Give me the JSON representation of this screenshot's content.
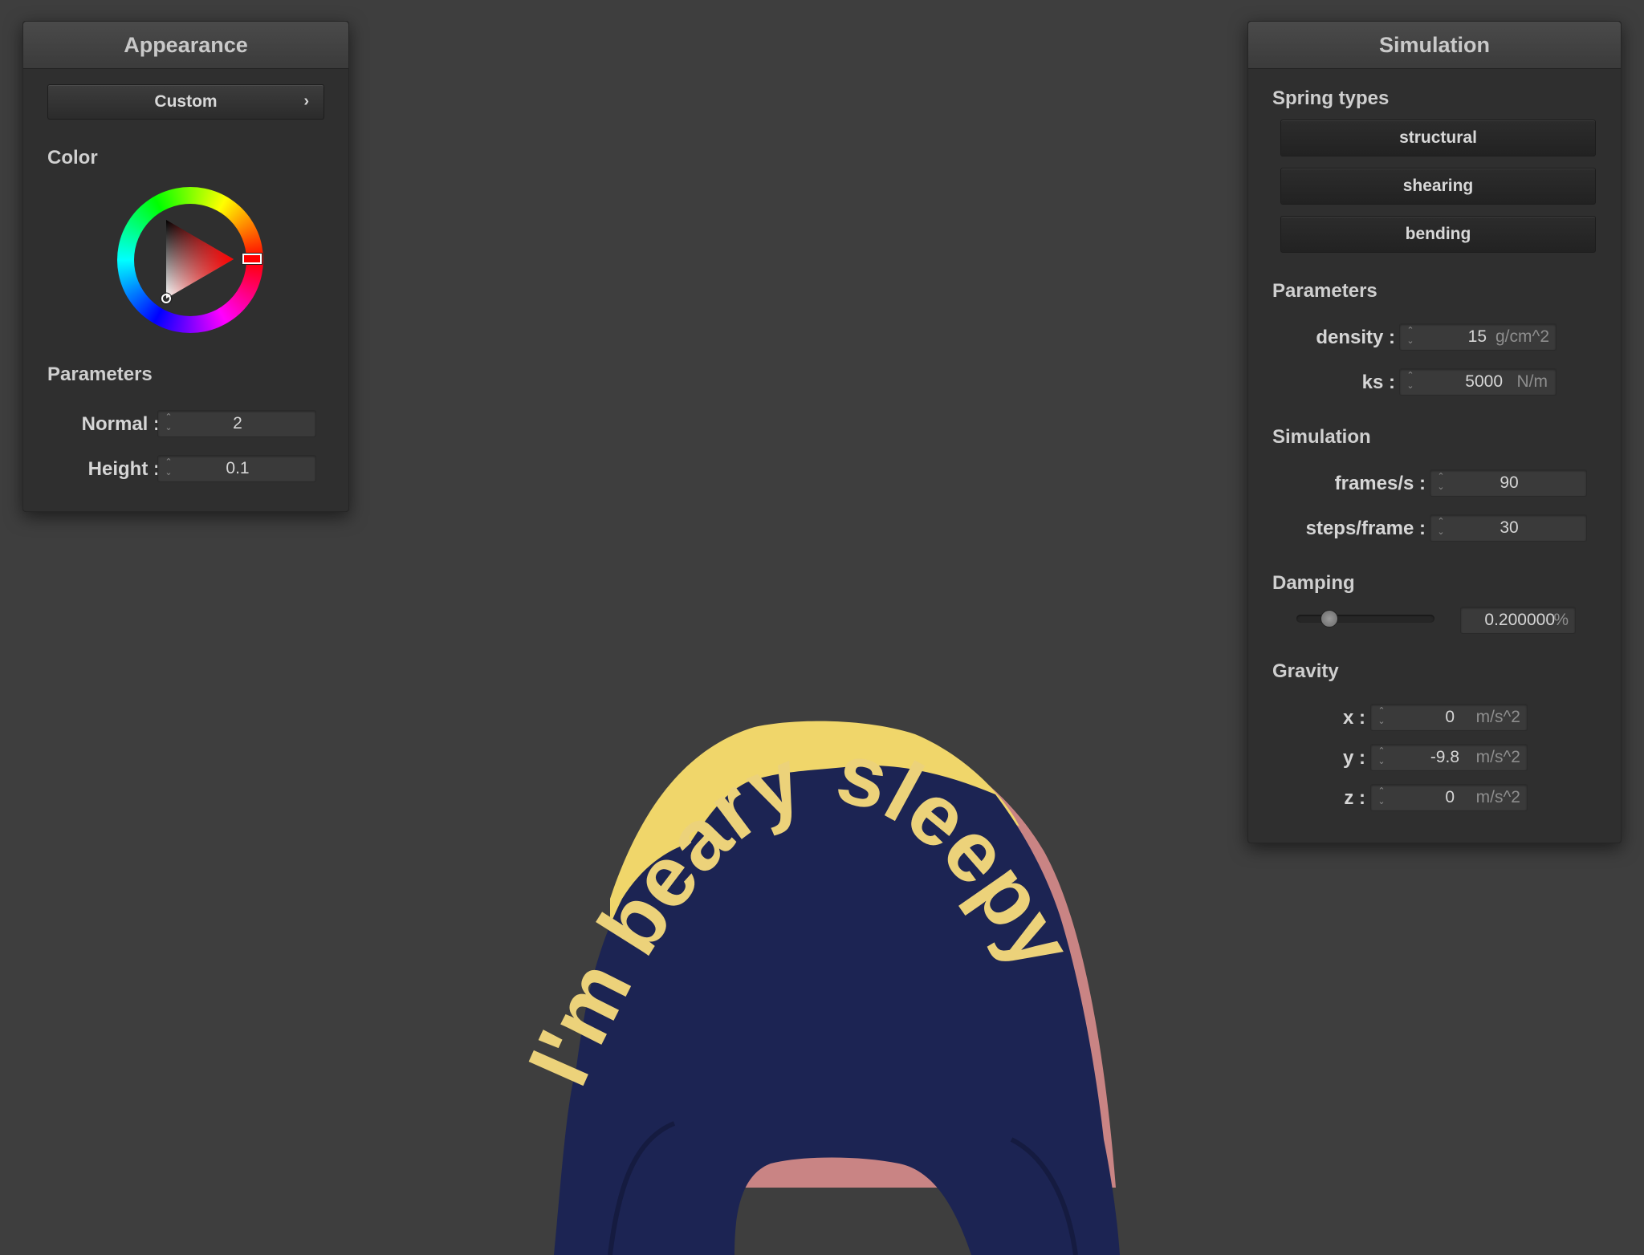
{
  "appearance": {
    "title": "Appearance",
    "preset_button": "Custom",
    "preset_chevron": "›",
    "color_label": "Color",
    "parameters_label": "Parameters",
    "normal": {
      "label": "Normal :",
      "value": "2"
    },
    "height": {
      "label": "Height :",
      "value": "0.1"
    },
    "selected_hue_hex": "#ff0000"
  },
  "simulation": {
    "title": "Simulation",
    "spring_types_label": "Spring types",
    "spring_buttons": [
      "structural",
      "shearing",
      "bending"
    ],
    "parameters_label": "Parameters",
    "density": {
      "label": "density :",
      "value": "15",
      "unit": "g/cm^2"
    },
    "ks": {
      "label": "ks :",
      "value": "5000",
      "unit": "N/m"
    },
    "simulation_label": "Simulation",
    "frames_per_s": {
      "label": "frames/s :",
      "value": "90"
    },
    "steps_per_frame": {
      "label": "steps/frame :",
      "value": "30"
    },
    "damping_label": "Damping",
    "damping": {
      "value": "0.200000",
      "unit": "%",
      "slider_fraction": 0.2
    },
    "gravity_label": "Gravity",
    "gravity_x": {
      "label": "x :",
      "value": "0",
      "unit": "m/s^2"
    },
    "gravity_y": {
      "label": "y :",
      "value": "-9.8",
      "unit": "m/s^2"
    },
    "gravity_z": {
      "label": "z :",
      "value": "0",
      "unit": "m/s^2"
    }
  },
  "viewport": {
    "cloth_text": "I'm beary sleepy"
  },
  "colors": {
    "background": "#3e3e3e",
    "panel": "#2f2f2f",
    "cloth_navy": "#1c2453",
    "cloth_yellow": "#f0d66a",
    "cloth_pink": "#c98484"
  }
}
